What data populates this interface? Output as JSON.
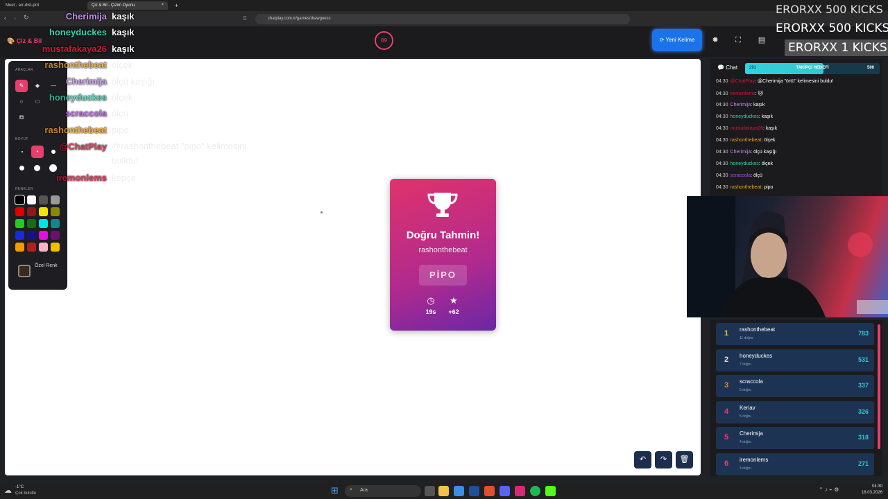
{
  "browser": {
    "tabs": [
      {
        "label": "Meet - arr-dist-prd",
        "active": false
      },
      {
        "label": "Çiz & Bil - Çizim Oyunu",
        "active": true
      }
    ],
    "new_tab": "+",
    "url": "chatplay.com.tr/games/drawguess"
  },
  "header": {
    "brand": "Çiz & Bil",
    "timer": "89",
    "new_word_label": "Yeni Kelime"
  },
  "tools": {
    "section_tools": "ARAÇLAR",
    "section_size": "BOYUT",
    "section_colors": "RENKLER",
    "custom_color_label": "Özel Renk",
    "colors": [
      "#000000",
      "#ffffff",
      "#555555",
      "#999999",
      "#e00000",
      "#8b1a1a",
      "#f5e400",
      "#8a8a00",
      "#22cc22",
      "#127012",
      "#00e5e5",
      "#0d8a8a",
      "#1a2ae0",
      "#12138a",
      "#e010e0",
      "#6a1070",
      "#f59a00",
      "#b02020",
      "#f8b4c8",
      "#f0c000"
    ]
  },
  "overlay_chat": [
    {
      "user": "Cherimija",
      "text": "kaşık",
      "user_color": "#c08ee8",
      "faded": false
    },
    {
      "user": "honeyduckes",
      "text": "kaşık",
      "user_color": "#37d4b3",
      "faded": false
    },
    {
      "user": "mustafakaya26",
      "text": "kaşık",
      "user_color": "#d4143c",
      "faded": false
    },
    {
      "user": "rashonthebeat",
      "text": "ölçek",
      "user_color": "#f0a01e",
      "faded": true
    },
    {
      "user": "Cherimija",
      "text": "ölçü kaşığı",
      "user_color": "#c08ee8",
      "faded": true
    },
    {
      "user": "honeyduckes",
      "text": "ölçek",
      "user_color": "#37d4b3",
      "faded": true
    },
    {
      "user": "scraccola",
      "text": "ölçü",
      "user_color": "#b04ee0",
      "faded": true
    },
    {
      "user": "rashonthebeat",
      "text": "pipo",
      "user_color": "#f0a01e",
      "faded": true
    },
    {
      "user": "@ChatPlay",
      "text": "@rashonthebeat \"pipo\" kelimesini bulldu!",
      "user_color": "#d4143c",
      "faded": true
    },
    {
      "user": "iremonlems",
      "text": "kepçe",
      "user_color": "#d4143c",
      "faded": true
    }
  ],
  "result_card": {
    "title": "Doğru Tahmin!",
    "player": "rashonthebeat",
    "word": "PİPO",
    "time": "19s",
    "points": "+62"
  },
  "chat": {
    "title": "Chat",
    "follower_goal": {
      "label": "TAKİPÇİ HEDEFİ",
      "current": "291",
      "target": "500",
      "progress": 0.58
    },
    "messages": [
      {
        "time": "04:30",
        "user": "@ChatPlay",
        "user_color": "#d4143c",
        "text": "@Cherimija \"örtü\" kelimesini buldu!"
      },
      {
        "time": "04:30",
        "user": "iremonlems",
        "user_color": "#d4143c",
        "text": "🐱"
      },
      {
        "time": "04:30",
        "user": "Cherimija",
        "user_color": "#c08ee8",
        "text": "kaşık"
      },
      {
        "time": "04:30",
        "user": "honeyduckes",
        "user_color": "#37d4b3",
        "text": "kaşık"
      },
      {
        "time": "04:30",
        "user": "mustafakaya26",
        "user_color": "#d4143c",
        "text": "kaşık"
      },
      {
        "time": "04:30",
        "user": "rashonthebeat",
        "user_color": "#f0a01e",
        "text": "ölçek"
      },
      {
        "time": "04:30",
        "user": "Cherimija",
        "user_color": "#c08ee8",
        "text": "ölçü kaşığı"
      },
      {
        "time": "04:30",
        "user": "honeyduckes",
        "user_color": "#37d4b3",
        "text": "ölçek"
      },
      {
        "time": "04:30",
        "user": "scraccola",
        "user_color": "#b04ee0",
        "text": "ölçü"
      },
      {
        "time": "04:30",
        "user": "rashonthebeat",
        "user_color": "#f0a01e",
        "text": "pipo"
      }
    ]
  },
  "leaderboard": [
    {
      "rank": "1",
      "name": "rashonthebeat",
      "sub": "11 doğru",
      "score": "783",
      "rank_color": "#f5c518"
    },
    {
      "rank": "2",
      "name": "honeyduckes",
      "sub": "7 doğru",
      "score": "531",
      "rank_color": "#dddddd"
    },
    {
      "rank": "3",
      "name": "scraccola",
      "sub": "5 doğru",
      "score": "337",
      "rank_color": "#e08a2a"
    },
    {
      "rank": "4",
      "name": "Keriav",
      "sub": "5 doğru",
      "score": "326",
      "rank_color": "#e63e6d"
    },
    {
      "rank": "5",
      "name": "Cherimija",
      "sub": "4 doğru",
      "score": "318",
      "rank_color": "#e63e6d"
    },
    {
      "rank": "6",
      "name": "iremonlems",
      "sub": "4 doğru",
      "score": "271",
      "rank_color": "#e63e6d"
    }
  ],
  "stream_alerts": [
    "ERORXX  500 KICKS",
    "ERORXX  500 KICKS",
    "ERORXX  1 KICKS"
  ],
  "taskbar": {
    "weather_temp": "-1°C",
    "weather_text": "Çok bulutlu",
    "search_placeholder": "Ara",
    "clock_time": "04:30",
    "clock_date": "18.03.2026"
  },
  "accent_color": "#e63e6d"
}
